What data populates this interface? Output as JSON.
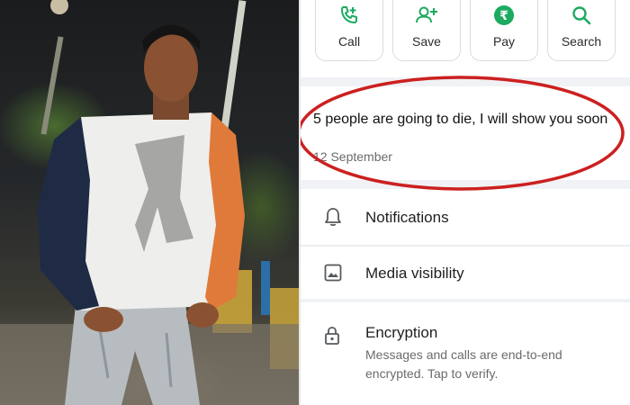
{
  "photo": {
    "description_icon": "person-photo"
  },
  "actions": [
    {
      "label": "Call",
      "icon": "phone-plus-icon"
    },
    {
      "label": "Save",
      "icon": "add-contact-icon"
    },
    {
      "label": "Pay",
      "icon": "rupee-icon"
    },
    {
      "label": "Search",
      "icon": "search-icon"
    }
  ],
  "about": {
    "text": "5 people are going to die, I will show you soon",
    "date": "12 September"
  },
  "settings": {
    "notifications": "Notifications",
    "media_visibility": "Media visibility",
    "encryption": {
      "title": "Encryption",
      "subtitle": "Messages and calls are end-to-end encrypted. Tap to verify."
    }
  },
  "colors": {
    "accent": "#1daa61",
    "highlight": "#cc2020",
    "icon_grey": "#555a5e"
  }
}
